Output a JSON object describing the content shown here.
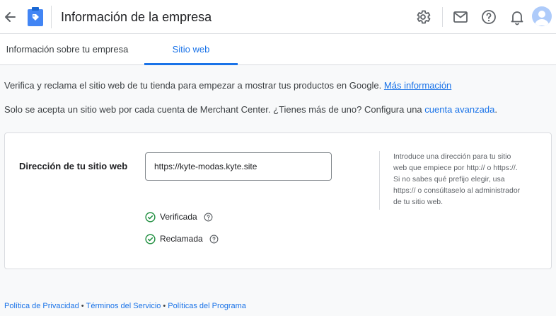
{
  "header": {
    "title": "Información de la empresa",
    "icons": [
      "back-arrow-icon",
      "merchant-center-logo",
      "gear-icon",
      "mail-icon",
      "help-icon",
      "bell-icon",
      "avatar"
    ]
  },
  "tabs": [
    {
      "label": "Información sobre tu empresa",
      "active": false
    },
    {
      "label": "Sitio web",
      "active": true
    }
  ],
  "intro": {
    "line1_text": "Verifica y reclama el sitio web de tu tienda para empezar a mostrar tus productos en Google.",
    "line1_link": "Más información",
    "line2_text": "Solo se acepta un sitio web por cada cuenta de Merchant Center. ¿Tienes más de uno? Configura una",
    "line2_link": "cuenta avanzada",
    "line2_end": "."
  },
  "website": {
    "label": "Dirección de tu sitio web",
    "value": "https://kyte-modas.kyte.site",
    "help_lines": [
      "Introduce una dirección para tu sitio",
      "web que empiece por http:// o https://.",
      "Si no sabes qué prefijo elegir, usa",
      "https:// o consúltaselo al administrador",
      "de tu sitio web."
    ],
    "statuses": [
      {
        "label": "Verificada"
      },
      {
        "label": "Reclamada"
      }
    ]
  },
  "footer": {
    "links": [
      "Política de Privacidad",
      "Términos del Servicio",
      "Políticas del Programa"
    ],
    "separator": "•"
  },
  "colors": {
    "accent": "#1a73e8",
    "success": "#1e8e3e",
    "logo": "#4285f4"
  }
}
